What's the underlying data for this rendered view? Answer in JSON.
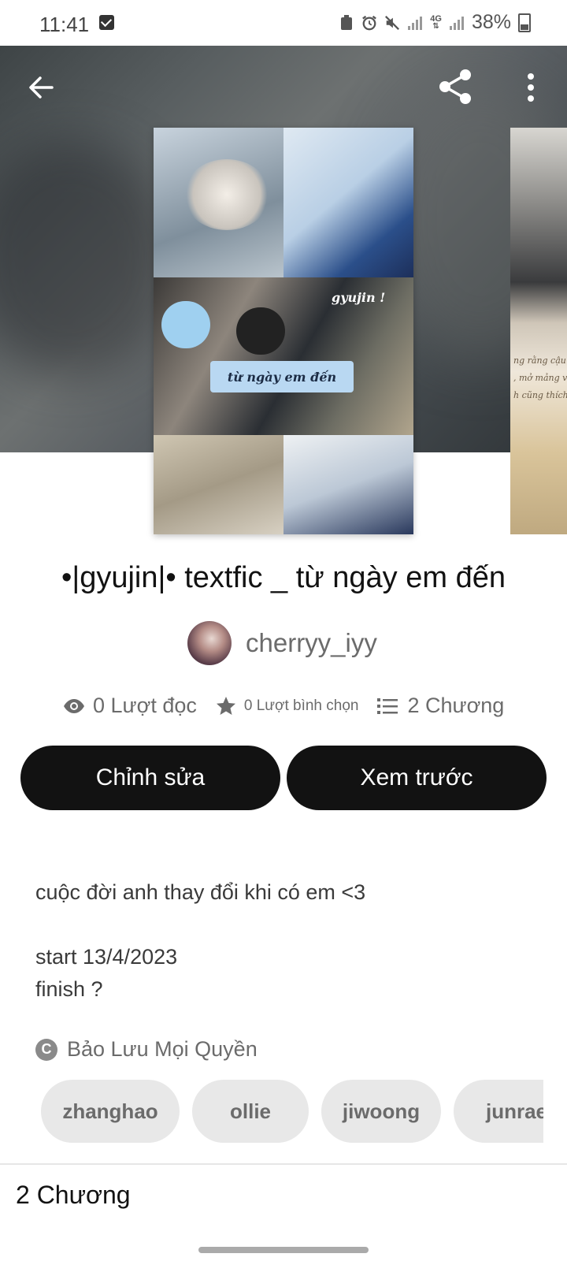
{
  "status_bar": {
    "time": "11:41",
    "battery": "38%",
    "network": "4G"
  },
  "story": {
    "title": "•|gyujin|• textfic _ từ ngày em đến",
    "author": "cherryy_iyy",
    "cover_banner": "từ ngày em đến",
    "cover_tag": "gyujin !"
  },
  "stats": {
    "reads": "0 Lượt đọc",
    "votes": "0 Lượt bình chọn",
    "parts": "2 Chương"
  },
  "actions": {
    "edit": "Chỉnh sửa",
    "preview": "Xem trước"
  },
  "description": {
    "line1": "cuộc đời anh thay đổi khi có em <3",
    "line2": "start 13/4/2023",
    "line3": "finish ?"
  },
  "copyright": "Bảo Lưu Mọi Quyền",
  "tags": [
    "zhanghao",
    "ollie",
    "jiwoong",
    "junrae"
  ],
  "section": {
    "chapters_header": "2 Chương"
  },
  "colors": {
    "button_bg": "#121212",
    "tag_bg": "#e8e8e8",
    "muted_text": "#6b6b6b"
  }
}
